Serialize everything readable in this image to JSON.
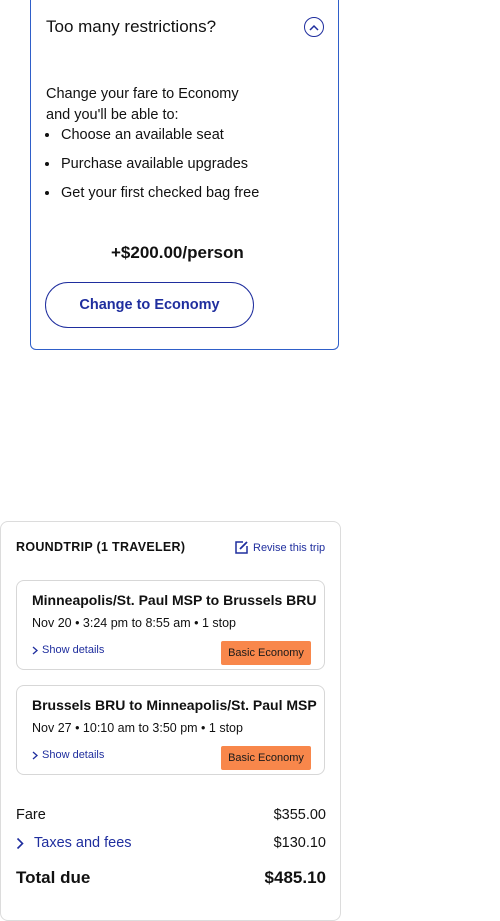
{
  "upsell": {
    "title": "Too many restrictions?",
    "description": "Change your fare to Economy and you'll be able to:",
    "benefits": [
      "Choose an available seat",
      "Purchase available upgrades",
      "Get your first checked bag free"
    ],
    "price": "+$200.00/person",
    "cta_label": "Change to Economy",
    "collapse_icon": "chevron-up-icon"
  },
  "summary": {
    "header": "ROUNDTRIP (1 TRAVELER)",
    "revise_label": "Revise this trip",
    "revise_icon": "edit-icon",
    "flights": [
      {
        "route": "Minneapolis/St. Paul MSP to Brussels BRU",
        "time": "Nov 20 • 3:24 pm to 8:55 am • 1 stop",
        "details_label": "Show details",
        "fare_class": "Basic Economy"
      },
      {
        "route": "Brussels BRU to Minneapolis/St. Paul MSP",
        "time": "Nov 27 • 10:10 am to 3:50 pm • 1 stop",
        "details_label": "Show details",
        "fare_class": "Basic Economy"
      }
    ],
    "fare_label": "Fare",
    "fare_value": "$355.00",
    "taxes_label": "Taxes and fees",
    "taxes_value": "$130.10",
    "total_label": "Total due",
    "total_value": "$485.10"
  },
  "colors": {
    "accent": "#1f2e9e",
    "card_border": "#2f5fc9",
    "badge_bg": "#f8874b"
  }
}
